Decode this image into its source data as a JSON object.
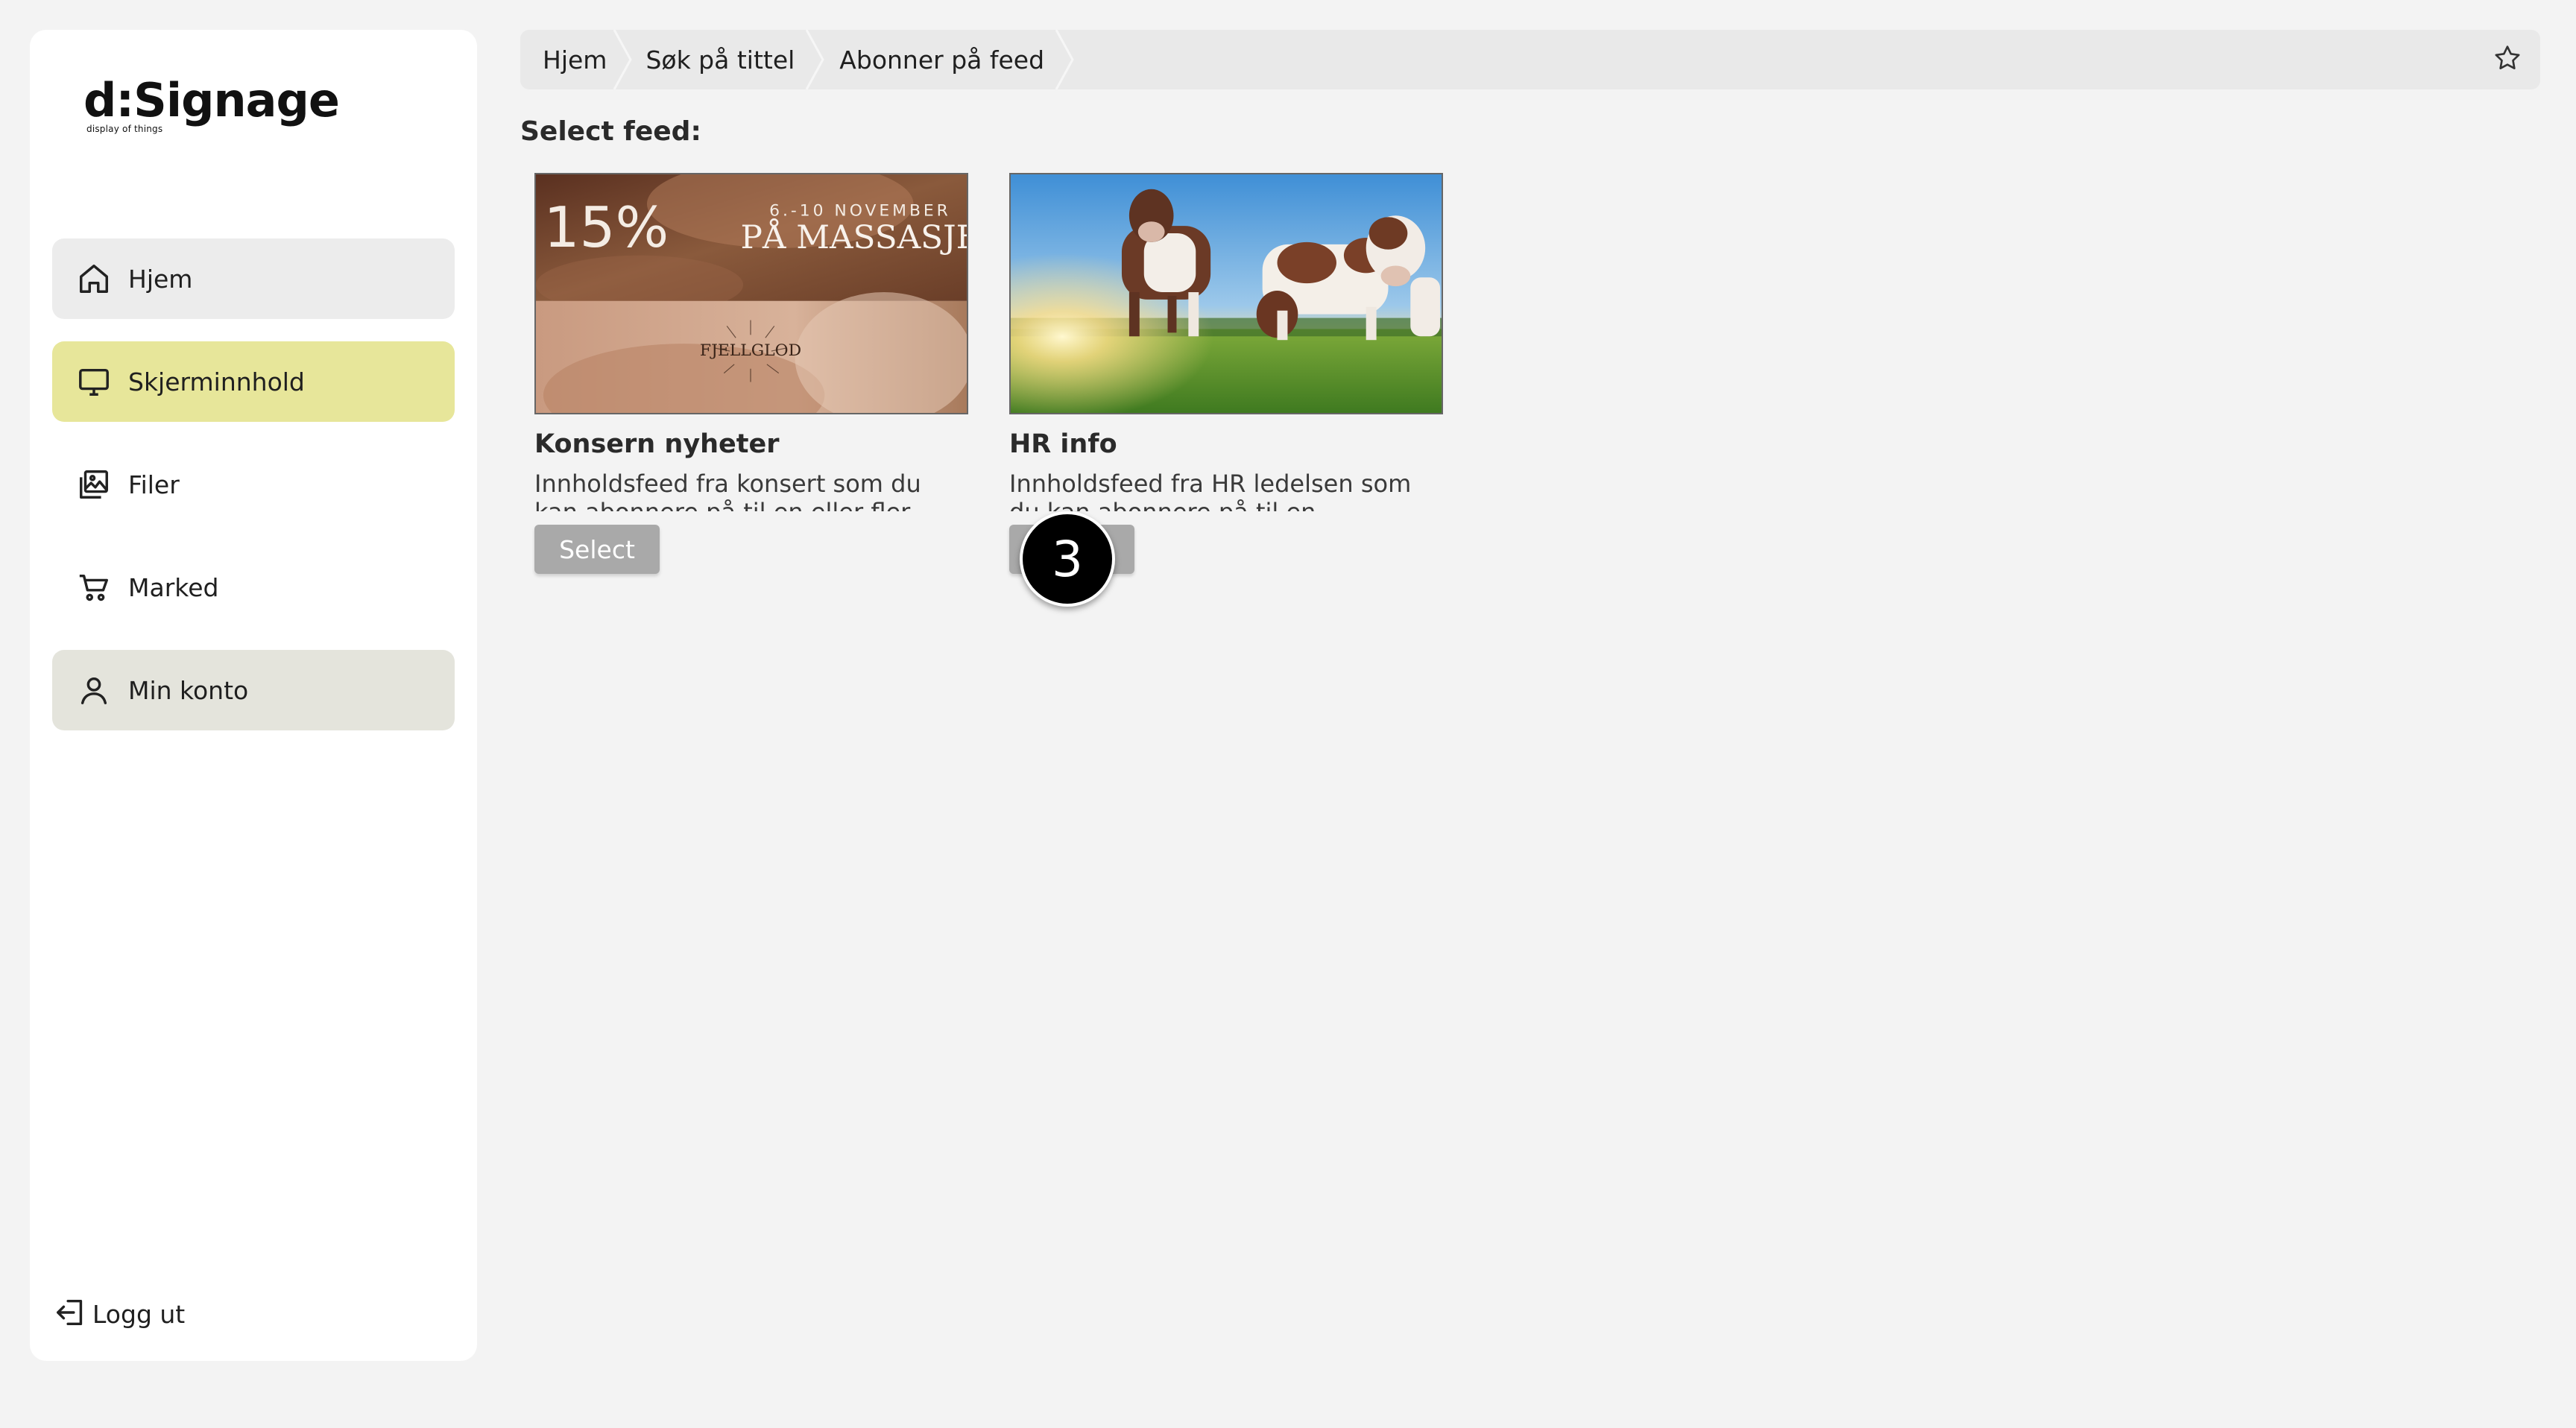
{
  "brand": {
    "logo_text": "d:Signage",
    "tagline": "display of things"
  },
  "sidebar": {
    "items": [
      {
        "label": "Hjem",
        "icon": "home-icon"
      },
      {
        "label": "Skjerminnhold",
        "icon": "monitor-icon",
        "active": true
      },
      {
        "label": "Filer",
        "icon": "images-icon"
      },
      {
        "label": "Marked",
        "icon": "cart-icon"
      },
      {
        "label": "Min konto",
        "icon": "user-icon"
      }
    ],
    "logout_label": "Logg ut"
  },
  "breadcrumb": [
    "Hjem",
    "Søk på tittel",
    "Abonner på feed"
  ],
  "main": {
    "title": "Select feed:",
    "feeds": [
      {
        "title": "Konsern nyheter",
        "description": "Innholdsfeed fra konsert som du kan abonnere på til en eller fler",
        "button_label": "Select",
        "image": {
          "percent": "15%",
          "dates": "6.-10 NOVEMBER",
          "headline": "PÅ MASSASJE",
          "brand": "FJELLGLOD"
        }
      },
      {
        "title": "HR info",
        "description": "Innholdsfeed fra HR ledelsen som du kan abonnere på til en",
        "button_label": "Select"
      }
    ]
  },
  "annotation": {
    "step": "3"
  },
  "colors": {
    "active_nav": "#e7e69a",
    "nav_hover": "#ececec",
    "button_gray": "#a9a9a9",
    "background": "#f3f3f3"
  }
}
